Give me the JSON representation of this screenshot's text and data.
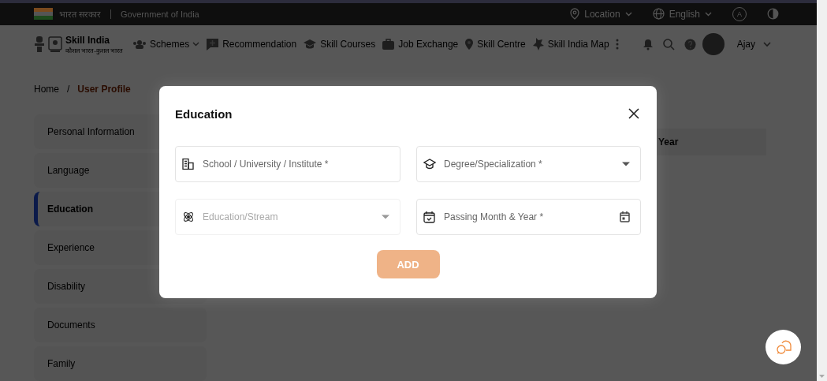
{
  "top_bar": {
    "hindi_label": "भारत सरकार",
    "government": "Government of India",
    "location": "Location",
    "language": "English",
    "font_toggle": "A"
  },
  "nav": {
    "brand": "Skill India",
    "tagline": "कौशल भारत-कुशल भारत",
    "user": "Ajay",
    "items": [
      {
        "label": "Schemes",
        "dropdown": true
      },
      {
        "label": "Recommendation",
        "dropdown": false
      },
      {
        "label": "Skill Courses",
        "dropdown": false
      },
      {
        "label": "Job Exchange",
        "dropdown": false
      },
      {
        "label": "Skill Centre",
        "dropdown": false
      },
      {
        "label": "Skill India Map",
        "dropdown": false
      }
    ]
  },
  "breadcrumb": {
    "separator": "/",
    "items": [
      {
        "label": "Home",
        "selected": false
      },
      {
        "label": "User Profile",
        "selected": true
      }
    ]
  },
  "sidebar": {
    "items": [
      {
        "label": "Personal Information",
        "selected": false
      },
      {
        "label": "Language",
        "selected": false
      },
      {
        "label": "Education",
        "selected": true
      },
      {
        "label": "Experience",
        "selected": false
      },
      {
        "label": "Disability",
        "selected": false
      },
      {
        "label": "Documents",
        "selected": false
      },
      {
        "label": "Family",
        "selected": false
      }
    ]
  },
  "content": {
    "header_text": "Year"
  },
  "modal": {
    "title": "Education",
    "submit": "ADD",
    "fields": [
      {
        "placeholder": "School / University / Institute *",
        "kind": "text",
        "disabled": false
      },
      {
        "placeholder": "Degree/Specialization *",
        "kind": "select",
        "disabled": false
      },
      {
        "placeholder": "Education/Stream",
        "kind": "select",
        "disabled": true
      },
      {
        "placeholder": "Passing Month & Year *",
        "kind": "date",
        "disabled": false
      }
    ]
  }
}
